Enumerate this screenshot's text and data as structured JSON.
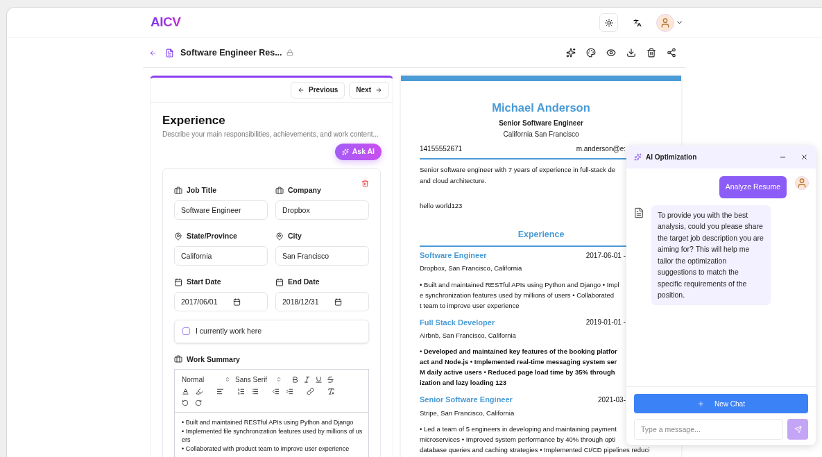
{
  "app": {
    "logo": "AICV"
  },
  "document": {
    "title": "Software Engineer Res...",
    "locked": true
  },
  "editor": {
    "nav": {
      "previous": "Previous",
      "next": "Next"
    },
    "section_title": "Experience",
    "section_description": "Describe your main responsibilities, achievements, and work content...",
    "ask_ai": "Ask AI",
    "fields": [
      {
        "label": "Job Title",
        "value": "Software Engineer",
        "kind": "text"
      },
      {
        "label": "Company",
        "value": "Dropbox",
        "kind": "text"
      },
      {
        "label": "State/Province",
        "value": "California",
        "kind": "text"
      },
      {
        "label": "City",
        "value": "San Francisco",
        "kind": "text"
      },
      {
        "label": "Start Date",
        "value": "2017/06/01",
        "kind": "date"
      },
      {
        "label": "End Date",
        "value": "2018/12/31",
        "kind": "date"
      }
    ],
    "current_job": {
      "label": "I currently work here",
      "checked": false
    },
    "summary": {
      "label": "Work Summary",
      "header_select": "Normal",
      "font_select": "Sans Serif",
      "lines": [
        "• Built and maintained RESTful APIs using Python and Django",
        "• Implemented file synchronization features used by millions of us",
        "ers",
        "• Collaborated with product team to improve user experience"
      ]
    }
  },
  "preview": {
    "name": "Michael Anderson",
    "headline": "Senior Software Engineer",
    "location": "California San Francisco",
    "phone": "14155552671",
    "email": "m.anderson@e:",
    "summary": "Senior software engineer with 7 years of experience in full-stack de\nand cloud architecture.",
    "note": "hello world123",
    "section_title": "Experience",
    "jobs": [
      {
        "title": "Software Engineer",
        "dates": "2017-06-01 -",
        "place": "Dropbox, San Francisco, California",
        "bold": false,
        "lines": [
          "• Built and maintained RESTful APIs using Python and Django • Impl",
          "e synchronization features used by millions of users • Collaborated",
          "t team to improve user experience"
        ]
      },
      {
        "title": "Full Stack Developer",
        "dates": "2019-01-01 -",
        "place": "Airbnb, San Francisco, California",
        "bold": true,
        "lines": [
          "• Developed and maintained key features of the booking platfor",
          "act and Node.js • Implemented real-time messaging system ser",
          "M daily active users • Reduced page load time by 35% through",
          "ization and lazy loading 123"
        ]
      },
      {
        "title": "Senior Software Engineer",
        "dates": "2021-03-",
        "place": "Stripe, San Francisco, California",
        "bold": false,
        "lines": [
          "• Led a team of 5 engineers in developing and maintaining payment",
          "microservices • Improved system performance by 40% through opti",
          "database queries and caching strategies • Implemented CI/CD pipelines reduci"
        ]
      }
    ]
  },
  "chat": {
    "title": "AI Optimization",
    "messages": [
      {
        "kind": "user",
        "text": "Analyze Resume"
      },
      {
        "kind": "assistant",
        "text": "To provide you with the best analysis, could you please share the target job description you are aiming for? This will help me tailor the optimization suggestions to match the specific requirements of the position."
      }
    ],
    "new_chat": "New Chat",
    "placeholder": "Type a message..."
  }
}
